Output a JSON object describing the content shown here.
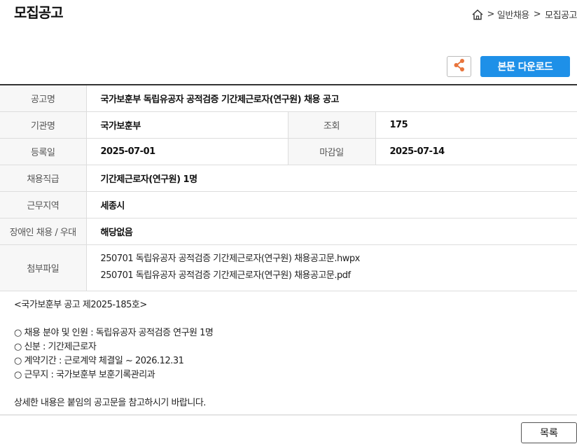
{
  "page": {
    "title": "모집공고"
  },
  "breadcrumb": {
    "sep1": ">",
    "item1": "일반채용",
    "sep2": ">",
    "item2": "모집공고"
  },
  "actions": {
    "download_label": "본문 다운로드",
    "list_label": "목록"
  },
  "notice": {
    "title_label": "공고명",
    "title_value": "국가보훈부 독립유공자 공적검증 기간제근로자(연구원) 채용 공고",
    "agency_label": "기관명",
    "agency_value": "국가보훈부",
    "views_label": "조회",
    "views_value": "175",
    "registered_label": "등록일",
    "registered_value": "2025-07-01",
    "deadline_label": "마감일",
    "deadline_value": "2025-07-14",
    "position_label": "채용직급",
    "position_value": "기간제근로자(연구원) 1명",
    "location_label": "근무지역",
    "location_value": "세종시",
    "disability_label": "장애인 채용 / 우대",
    "disability_value": "해당없음",
    "attachments_label": "첨부파일",
    "attachments": [
      "250701 독립유공자 공적검증 기간제근로자(연구원) 채용공고문.hwpx",
      "250701 독립유공자 공적검증 기간제근로자(연구원) 채용공고문.pdf"
    ]
  },
  "content": {
    "lines": [
      "<국가보훈부 공고 제2025-185호>",
      "",
      "○ 채용 분야 및 인원 : 독립유공자 공적검증 연구원 1명",
      "○ 신분 : 기간제근로자",
      "○ 계약기간 : 근로계약 체결일 ~ 2026.12.31",
      "○ 근무지 : 국가보훈부 보훈기록관리과",
      "",
      "상세한 내용은 붙임의 공고문을 참고하시기 바랍니다."
    ]
  }
}
